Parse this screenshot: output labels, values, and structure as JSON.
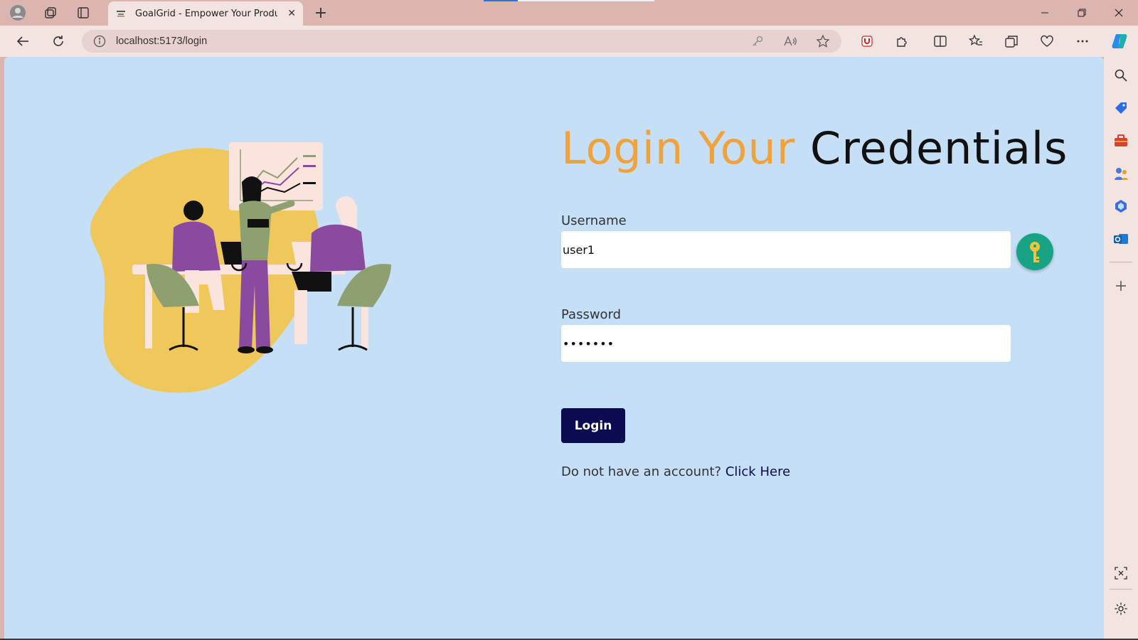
{
  "browser": {
    "tab_title": "GoalGrid - Empower Your Produc",
    "url": "localhost:5173/login",
    "load_progress": 0.2
  },
  "page": {
    "heading_accent": "Login Your",
    "heading_rest": "Credentials",
    "username_label": "Username",
    "username_value": "user1",
    "password_label": "Password",
    "password_value": "•••••••",
    "login_button": "Login",
    "signup_prompt": "Do not have an account?",
    "signup_link": "Click Here"
  },
  "colors": {
    "page_background": "#c5dff6",
    "accent": "#f2a23b",
    "button": "#0b0b52",
    "key_button": "#17a384",
    "blob": "#f0c75a"
  },
  "icons": {
    "titlebar": [
      "profile-icon",
      "workspaces-icon",
      "tab-actions-icon"
    ],
    "toolbar": [
      "back-icon",
      "refresh-icon",
      "site-info-icon",
      "password-key-icon",
      "read-aloud-icon",
      "favorite-star-icon",
      "shield-extension-icon",
      "extensions-icon",
      "split-screen-icon",
      "favorites-icon",
      "collections-icon",
      "browser-essentials-icon",
      "more-icon",
      "copilot-icon"
    ],
    "sidebar": [
      "search-icon",
      "shopping-tag-icon",
      "tools-icon",
      "games-icon",
      "microsoft365-icon",
      "outlook-icon",
      "add-icon",
      "screenshot-icon",
      "settings-icon"
    ]
  }
}
